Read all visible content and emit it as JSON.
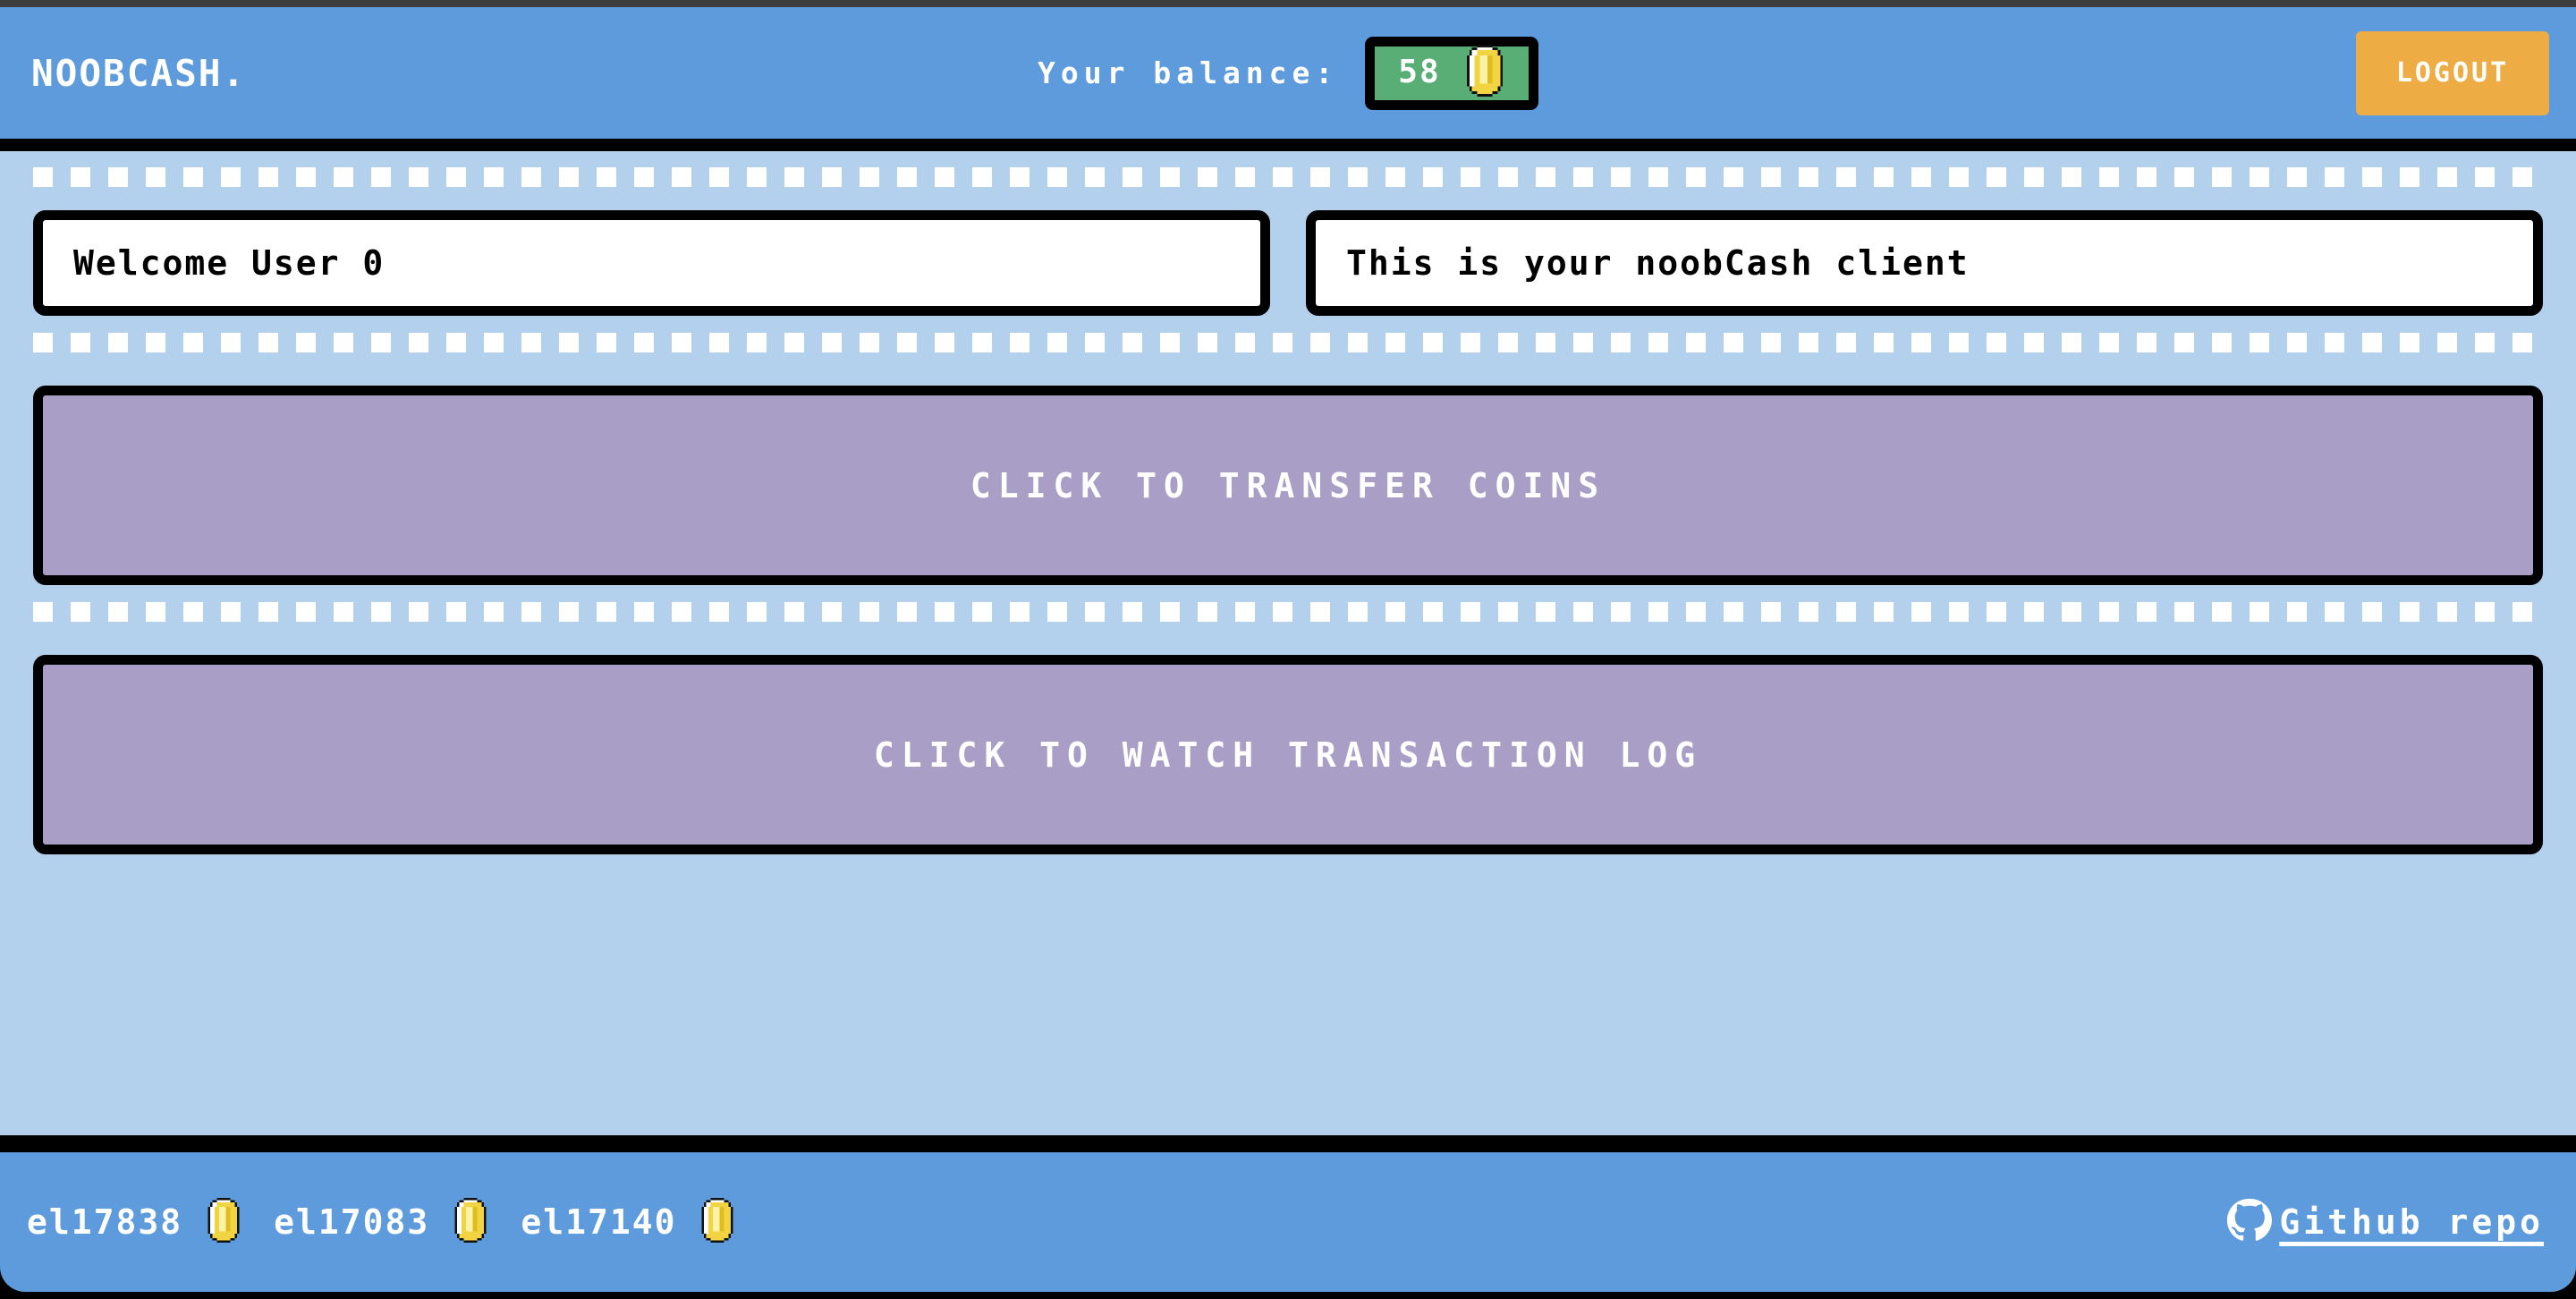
{
  "app": {
    "brand": "NOOBCASH.",
    "accent_blue": "#5e9bdc",
    "body_blue": "#b3d0ec",
    "button_purple": "#a99fc6",
    "badge_green": "#58ae74",
    "logout_orange": "#edad44",
    "coin_gold": "#f2d443"
  },
  "header": {
    "brand": "NOOBCASH.",
    "balance_label": "Your balance:",
    "balance_value": "58",
    "balance_coin_icon": "coin-icon",
    "logout_label": "LOGOUT"
  },
  "main": {
    "welcome_text": "Welcome User 0",
    "client_text": "This is your noobCash client",
    "transfer_button_label": "CLICK TO TRANSFER COINS",
    "log_button_label": "CLICK TO WATCH TRANSACTION LOG"
  },
  "footer": {
    "peers": [
      {
        "id": "el17838",
        "coin_icon": "coin-icon"
      },
      {
        "id": "el17083",
        "coin_icon": "coin-icon"
      },
      {
        "id": "el17140",
        "coin_icon": "coin-icon"
      }
    ],
    "repo_icon": "github-icon",
    "repo_label": "Github repo"
  }
}
